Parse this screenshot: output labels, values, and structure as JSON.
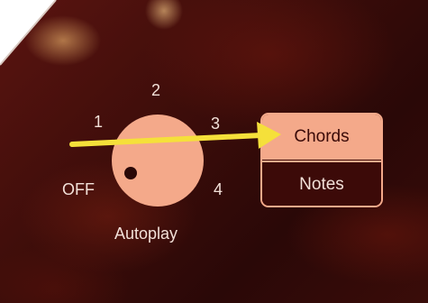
{
  "autoplay": {
    "label": "Autoplay",
    "positions": [
      "OFF",
      "1",
      "2",
      "3",
      "4"
    ],
    "selected": "OFF"
  },
  "mode_selector": {
    "options": [
      "Chords",
      "Notes"
    ],
    "selected": "Chords"
  },
  "colors": {
    "accent": "#f4a98a",
    "text": "#f2e0d8",
    "dark": "#3a0a08",
    "arrow": "#f5e03a"
  }
}
